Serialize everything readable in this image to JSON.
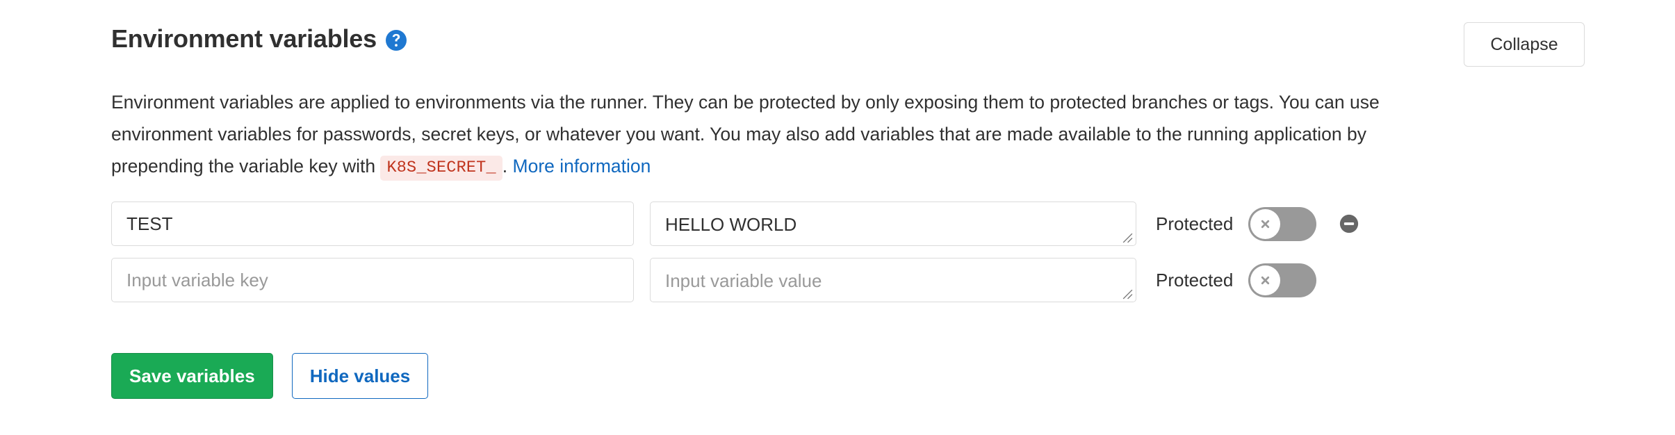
{
  "panel": {
    "title": "Environment variables",
    "help_icon_label": "?",
    "collapse_label": "Collapse",
    "description": {
      "part1": "Environment variables are applied to environments via the runner. They can be protected by only exposing them to protected branches or tags. You can use environment variables for passwords, secret keys, or whatever you want. You may also add variables that are made available to the running application by prepending the variable key with",
      "code": "K8S_SECRET_",
      "part2": ".",
      "link": "More information"
    }
  },
  "variables": [
    {
      "key_value": "TEST",
      "key_placeholder": "Input variable key",
      "value_value": "HELLO WORLD",
      "value_placeholder": "Input variable value",
      "protected_label": "Protected",
      "protected_on": false,
      "has_remove": true
    },
    {
      "key_value": "",
      "key_placeholder": "Input variable key",
      "value_value": "",
      "value_placeholder": "Input variable value",
      "protected_label": "Protected",
      "protected_on": false,
      "has_remove": false
    }
  ],
  "actions": {
    "save_label": "Save variables",
    "hide_label": "Hide values"
  },
  "colors": {
    "primary_green": "#1aaa55",
    "link_blue": "#1068bf",
    "code_red": "#c0341d",
    "code_bg": "#fbe9e7",
    "toggle_off": "#999999",
    "border": "#dbdbdb",
    "text": "#303030"
  }
}
